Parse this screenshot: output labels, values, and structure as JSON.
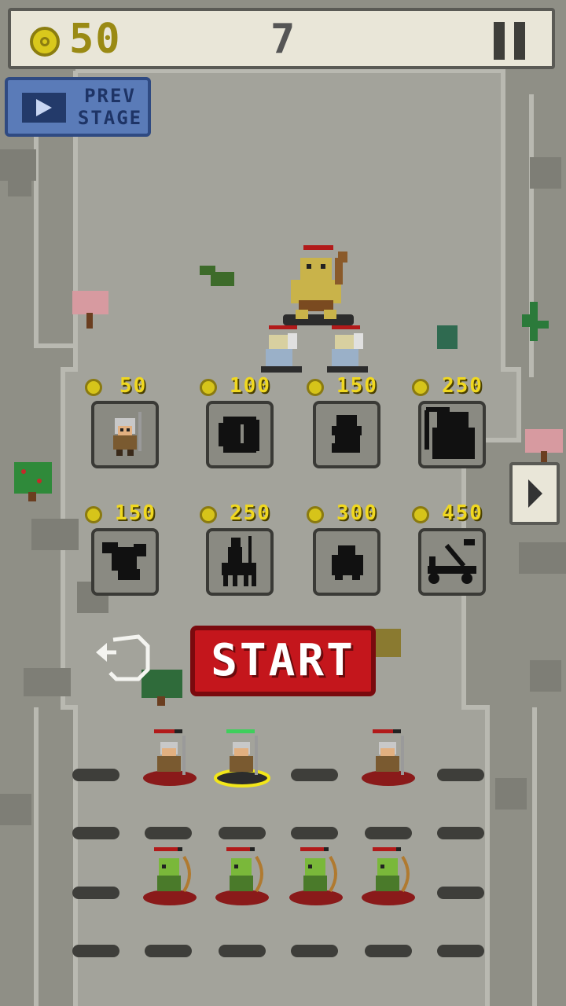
{
  "hud": {
    "coins": "50",
    "stage": "7",
    "pause_icon": "pause-icon"
  },
  "prev_stage": {
    "label_line1": "PREV",
    "label_line2": "STAGE",
    "icon": "video-icon"
  },
  "shop": {
    "row1": [
      {
        "price": "50",
        "unit": "spearman",
        "locked": false
      },
      {
        "price": "100",
        "unit": "shield-warrior",
        "locked": true
      },
      {
        "price": "150",
        "unit": "knight",
        "locked": true
      },
      {
        "price": "250",
        "unit": "reaper",
        "locked": true
      }
    ],
    "row2": [
      {
        "price": "150",
        "unit": "dragon",
        "locked": true
      },
      {
        "price": "250",
        "unit": "centaur",
        "locked": true
      },
      {
        "price": "300",
        "unit": "beast",
        "locked": true
      },
      {
        "price": "450",
        "unit": "catapult",
        "locked": true
      }
    ]
  },
  "controls": {
    "start_label": "START",
    "reset_icon": "undo-icon",
    "next_icon": "arrow-right-icon"
  },
  "colors": {
    "coin": "#d6c41a",
    "price_text": "#f0d820",
    "start_bg": "#c4161c",
    "prev_bg": "#5a7bb8",
    "selected": "#f2e61a",
    "health_green": "#3fcf5c",
    "health_red": "#b21a1a"
  }
}
